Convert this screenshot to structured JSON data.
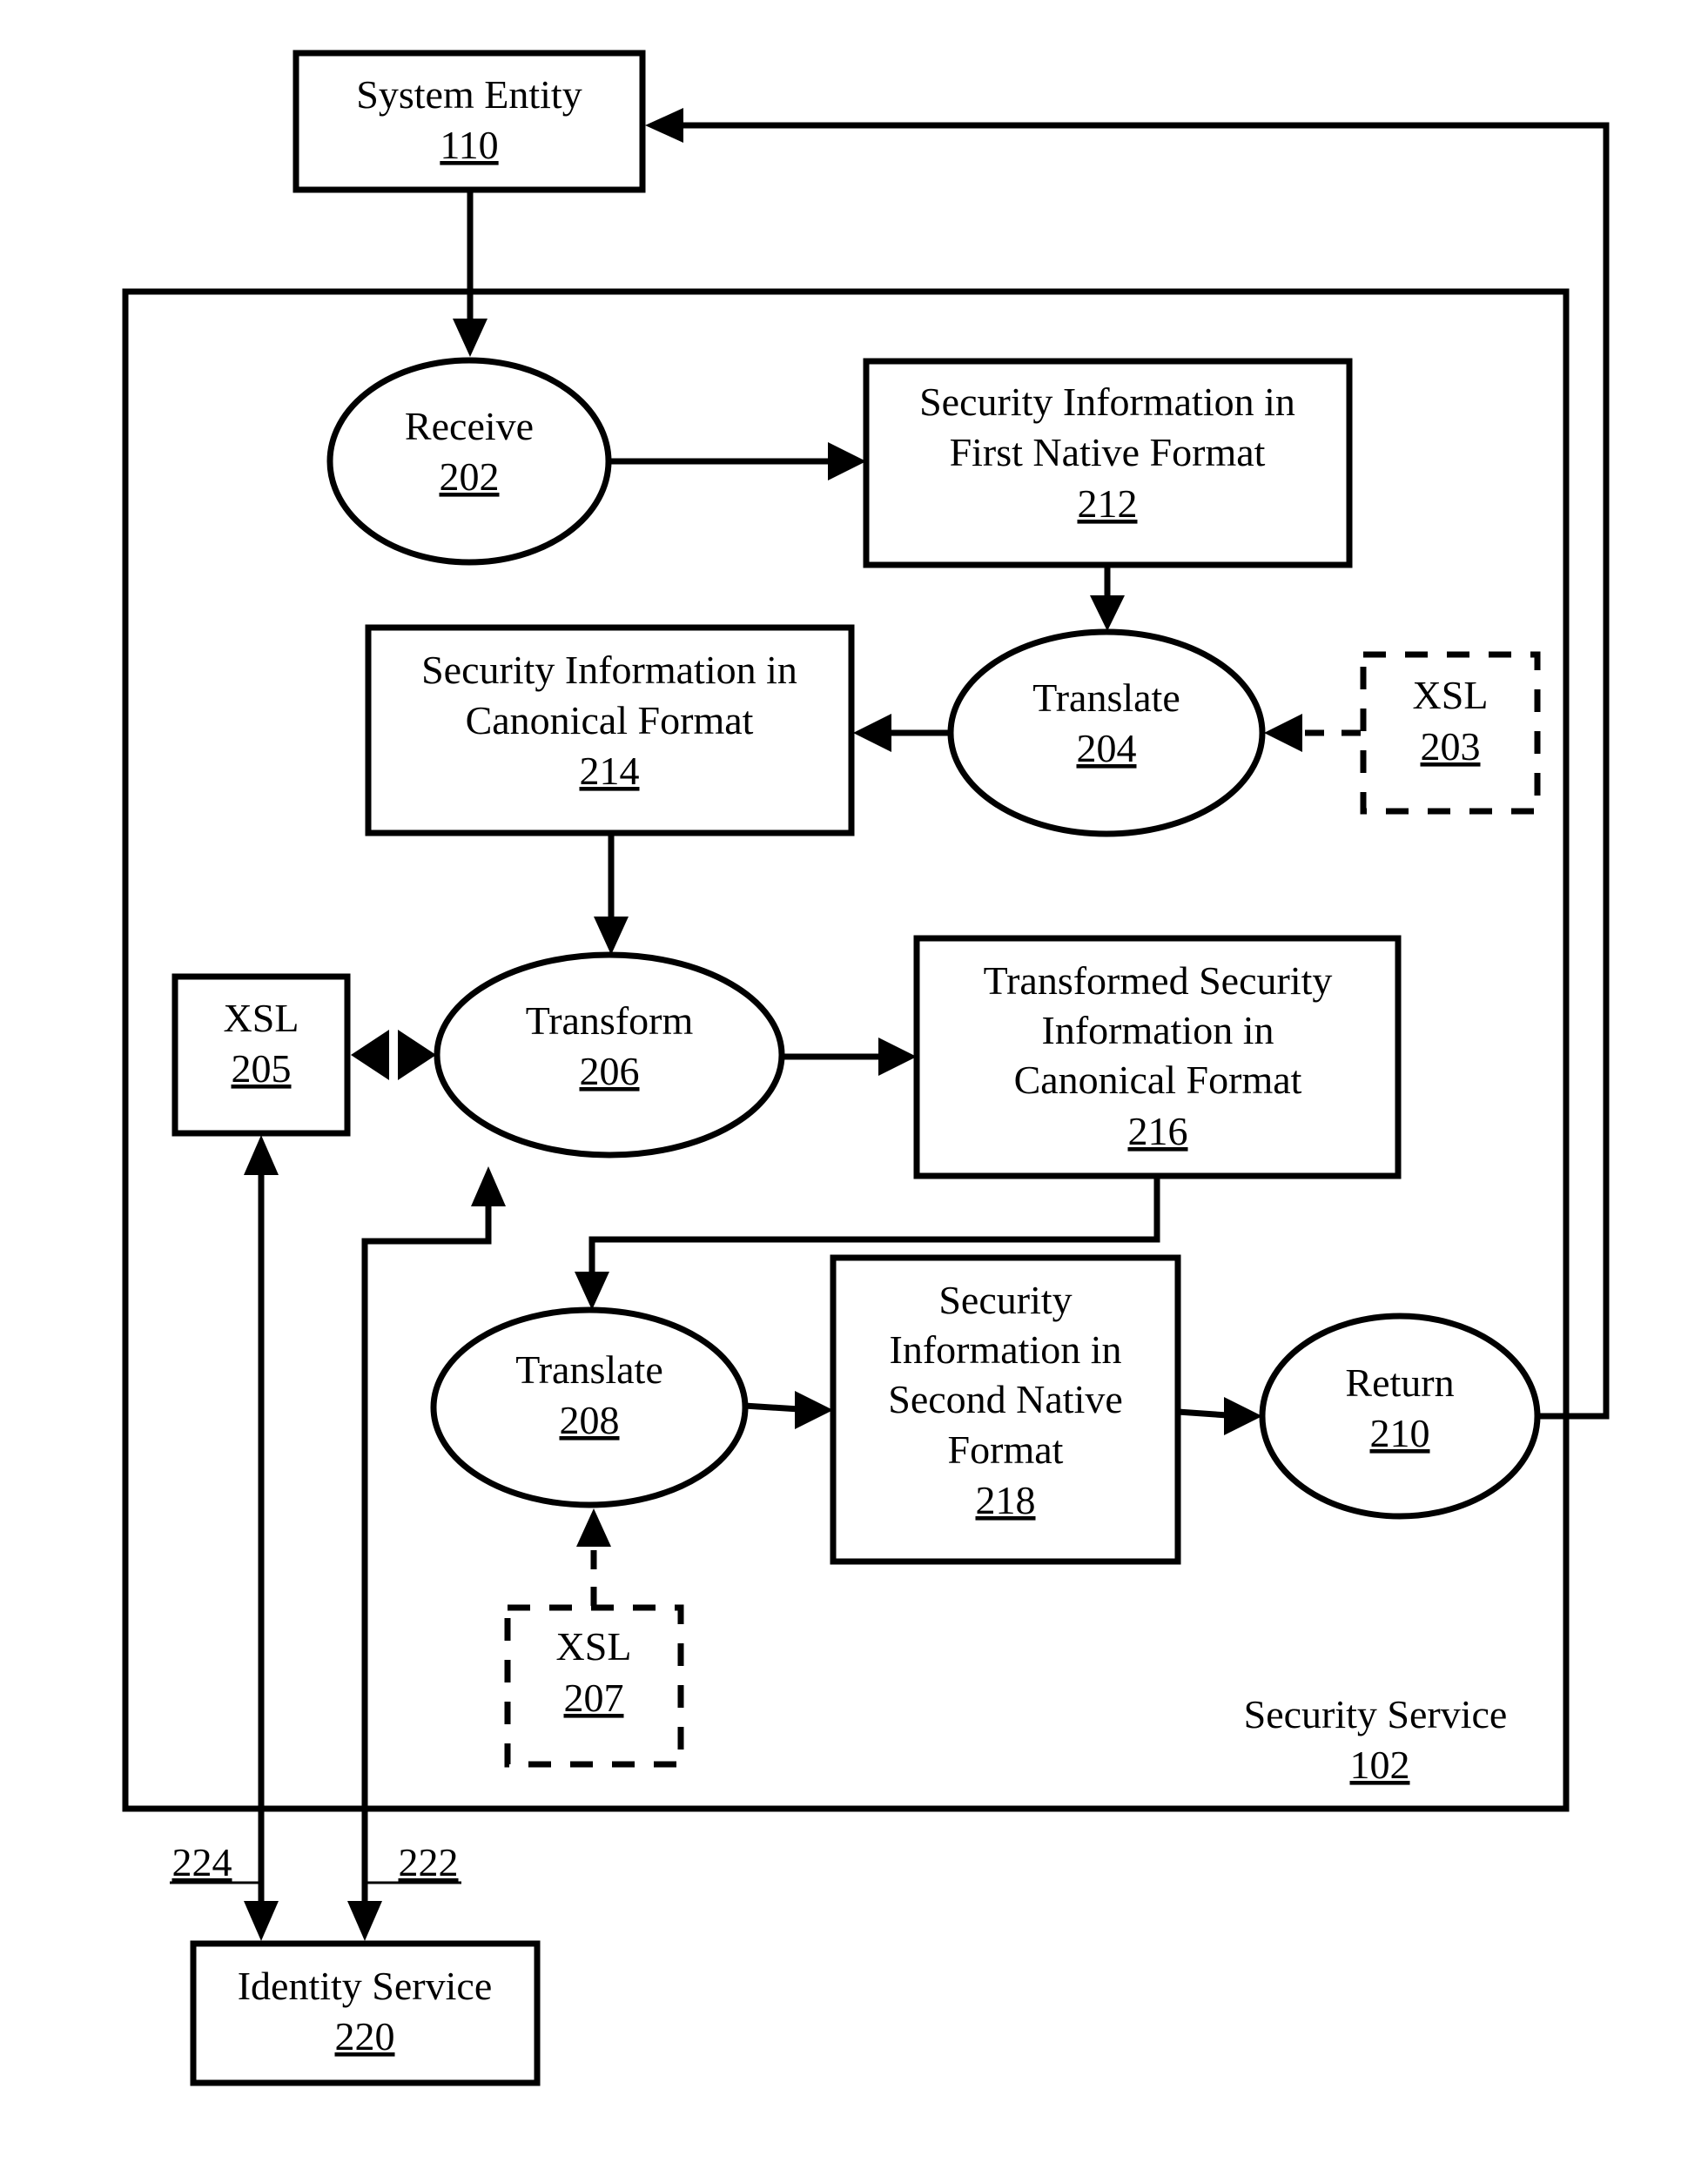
{
  "diagram": {
    "nodes": {
      "system_entity": {
        "lines": [
          "System Entity"
        ],
        "ref": "110"
      },
      "receive": {
        "lines": [
          "Receive"
        ],
        "ref": "202"
      },
      "first_native": {
        "lines": [
          "Security Information in",
          "First Native Format"
        ],
        "ref": "212"
      },
      "translate_204": {
        "lines": [
          "Translate"
        ],
        "ref": "204"
      },
      "xsl_203": {
        "lines": [
          "XSL"
        ],
        "ref": "203"
      },
      "canonical": {
        "lines": [
          "Security Information in",
          "Canonical Format"
        ],
        "ref": "214"
      },
      "xsl_205": {
        "lines": [
          "XSL"
        ],
        "ref": "205"
      },
      "transform": {
        "lines": [
          "Transform"
        ],
        "ref": "206"
      },
      "transformed": {
        "lines": [
          "Transformed Security",
          "Information in",
          "Canonical Format"
        ],
        "ref": "216"
      },
      "translate_208": {
        "lines": [
          "Translate"
        ],
        "ref": "208"
      },
      "second_native": {
        "lines": [
          "Security",
          "Information in",
          "Second Native",
          "Format"
        ],
        "ref": "218"
      },
      "return": {
        "lines": [
          "Return"
        ],
        "ref": "210"
      },
      "xsl_207": {
        "lines": [
          "XSL"
        ],
        "ref": "207"
      },
      "security_service": {
        "lines": [
          "Security Service"
        ],
        "ref": "102"
      },
      "identity_service": {
        "lines": [
          "Identity Service"
        ],
        "ref": "220"
      }
    },
    "edge_labels": {
      "link_224": "224",
      "link_222": "222"
    },
    "edges": [
      {
        "from": "System Entity 110",
        "to": "Receive 202"
      },
      {
        "from": "Receive 202",
        "to": "Security Information in First Native Format 212"
      },
      {
        "from": "212",
        "to": "Translate 204"
      },
      {
        "from": "XSL 203",
        "to": "Translate 204",
        "style": "dashed"
      },
      {
        "from": "Translate 204",
        "to": "Security Information in Canonical Format 214"
      },
      {
        "from": "214",
        "to": "Transform 206"
      },
      {
        "from": "XSL 205",
        "to": "Transform 206",
        "style": "bidirectional"
      },
      {
        "from": "Transform 206",
        "to": "Transformed Security Information in Canonical Format 216"
      },
      {
        "from": "216",
        "to": "Translate 208"
      },
      {
        "from": "XSL 207",
        "to": "Translate 208",
        "style": "dashed"
      },
      {
        "from": "Translate 208",
        "to": "Security Information in Second Native Format 218"
      },
      {
        "from": "218",
        "to": "Return 210"
      },
      {
        "from": "Return 210",
        "to": "System Entity 110"
      },
      {
        "from": "Identity Service 220",
        "to": "XSL 205",
        "label": "224",
        "style": "bidirectional"
      },
      {
        "from": "Identity Service 220",
        "to": "Transform 206",
        "label": "222",
        "style": "bidirectional"
      }
    ]
  }
}
